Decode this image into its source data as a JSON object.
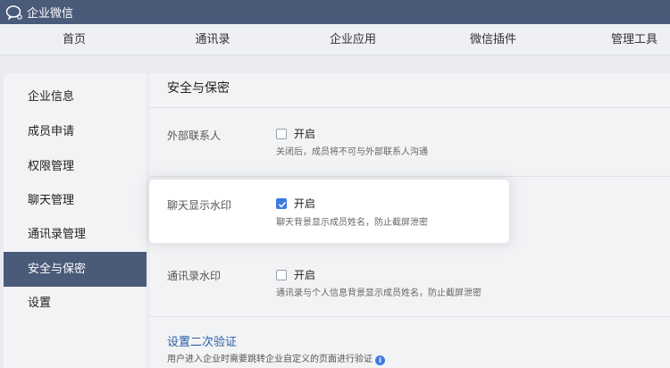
{
  "app": {
    "title": "企业微信",
    "logo_icon": "chat-bubbles-icon"
  },
  "nav": {
    "items": [
      "首页",
      "通讯录",
      "企业应用",
      "微信插件",
      "管理工具"
    ]
  },
  "sidebar": {
    "items": [
      "企业信息",
      "成员申请",
      "权限管理",
      "聊天管理",
      "通讯录管理",
      "安全与保密",
      "设置"
    ],
    "active_label": "安全与保密"
  },
  "main": {
    "title": "安全与保密",
    "external_contact": {
      "label": "外部联系人",
      "checkbox_label": "开启",
      "checked": false,
      "desc": "关闭后，成员将不可与外部联系人沟通"
    },
    "chat_watermark": {
      "label": "聊天显示水印",
      "checkbox_label": "开启",
      "checked": true,
      "desc": "聊天背景显示成员姓名，防止截屏泄密"
    },
    "contacts_watermark": {
      "label": "通讯录水印",
      "checkbox_label": "开启",
      "checked": false,
      "desc": "通讯录与个人信息背景显示成员姓名，防止截屏泄密"
    },
    "two_step": {
      "title": "设置二次验证",
      "desc": "用户进入企业时需要跳转企业自定义的页面进行验证",
      "info_icon": "info-icon"
    }
  },
  "colors": {
    "header_bg": "#4a5a79",
    "accent": "#3d7be3",
    "link": "#2a5ea8",
    "active_bg": "#4a5a79"
  }
}
